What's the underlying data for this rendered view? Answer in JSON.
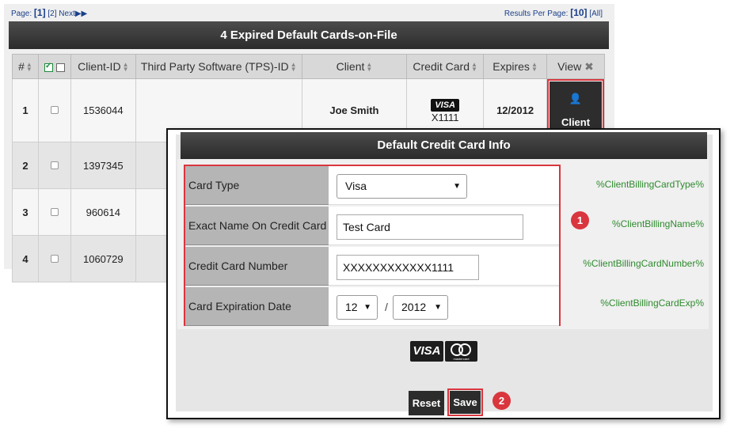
{
  "pager": {
    "label": "Page:",
    "current": "[1]",
    "other": "[2]",
    "next": "Next"
  },
  "results_per_page": {
    "label": "Results Per Page:",
    "current": "[10]",
    "all": "[All]"
  },
  "grid": {
    "title": "4  Expired Default Cards-on-File",
    "columns": [
      "#",
      "Client-ID",
      "Third Party Software (TPS)-ID",
      "Client",
      "Credit Card",
      "Expires",
      "View"
    ],
    "rows": [
      {
        "num": "1",
        "client_id": "1536044",
        "tps_id": "",
        "client": "Joe Smith",
        "card_brand": "VISA",
        "card_last": "X1111",
        "expires": "12/2012",
        "view": "Client"
      },
      {
        "num": "2",
        "client_id": "1397345"
      },
      {
        "num": "3",
        "client_id": "960614"
      },
      {
        "num": "4",
        "client_id": "1060729"
      }
    ]
  },
  "modal": {
    "title": "Default Credit Card Info",
    "fields": {
      "card_type": {
        "label": "Card Type",
        "value": "Visa",
        "token": "%ClientBillingCardType%"
      },
      "name": {
        "label": "Exact Name On Credit Card",
        "value": "Test Card",
        "token": "%ClientBillingName%"
      },
      "number": {
        "label": "Credit Card Number",
        "value": "XXXXXXXXXXXX1111",
        "token": "%ClientBillingCardNumber%"
      },
      "expiration": {
        "label": "Card Expiration Date",
        "month": "12",
        "separator": "/",
        "year": "2012",
        "token": "%ClientBillingCardExp%"
      }
    },
    "logos": {
      "visa": "VISA",
      "mastercard": "mastercard"
    },
    "reset_label": "Reset",
    "save_label": "Save",
    "markers": [
      "1",
      "2"
    ]
  },
  "colors": {
    "header_dark": "#2c2c2c",
    "highlight_red": "#d9363e",
    "token_green": "#2e8a2e",
    "link_blue": "#1a3f8a"
  }
}
